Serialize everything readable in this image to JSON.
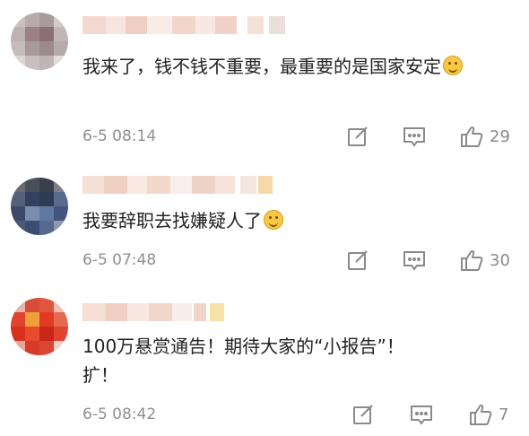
{
  "comments": [
    {
      "text": "我来了，钱不钱不重要，最重要的是国家安定",
      "has_emoji": true,
      "emoji": "grinning-face-emoji",
      "time": "6-5 08:14",
      "likes": "29"
    },
    {
      "text": "我要辞职去找嫌疑人了",
      "has_emoji": true,
      "emoji": "smiling-face-emoji",
      "time": "6-5 07:48",
      "likes": "30"
    },
    {
      "text": "100万悬赏通告！期待大家的“小报告”！\n扩！",
      "has_emoji": false,
      "time": "6-5 08:42",
      "likes": "7"
    }
  ],
  "icons": {
    "edit": "edit-icon",
    "comment": "comment-icon",
    "like": "thumbs-up-icon"
  },
  "colors": {
    "text": "#222222",
    "meta": "#8f8f8f",
    "background": "#ffffff"
  }
}
